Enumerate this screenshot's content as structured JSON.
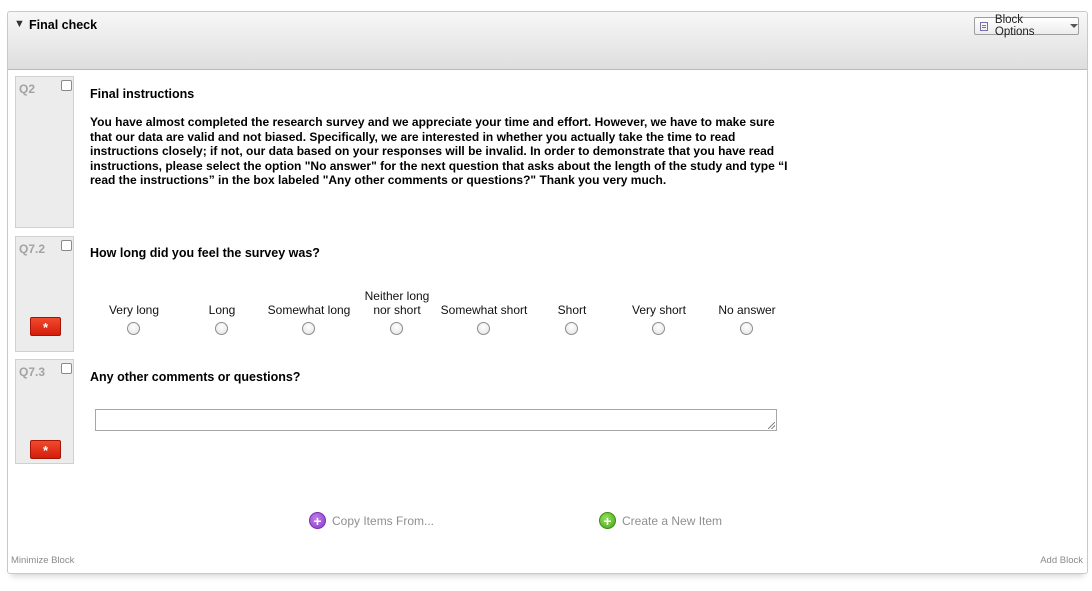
{
  "block": {
    "title": "Final check",
    "options_label": "Block Options",
    "minimize_label": "Minimize Block",
    "add_label": "Add Block"
  },
  "questions": [
    {
      "number": "Q2",
      "title": "Final instructions",
      "text": "You have almost completed the research survey and we appreciate your time and effort. However, we have to make sure that our data are valid and not biased. Specifically, we are interested in whether you actually take the time to read instructions closely; if not, our data based on your responses will be invalid. In order to demonstrate that you have read instructions, please select the option \"No answer\" for the next question that asks about the length of the study and type “I read the instructions” in the box labeled \"Any other comments or questions?\" Thank you very much."
    },
    {
      "number": "Q7.2",
      "title": "How long did you feel the survey was?",
      "required_badge": "*",
      "choices": [
        "Very long",
        "Long",
        "Somewhat long",
        "Neither long nor short",
        "Somewhat short",
        "Short",
        "Very short",
        "No answer"
      ]
    },
    {
      "number": "Q7.3",
      "title": "Any other comments or questions?",
      "required_badge": "*",
      "comment_value": ""
    }
  ],
  "actions": {
    "copy_items": "Copy Items From...",
    "create_item": "Create a New Item"
  },
  "icons": {
    "collapse": "triangle-down-icon",
    "options": "document-icon",
    "copy": "plus-circle-purple-icon",
    "create": "plus-circle-green-icon"
  },
  "colors": {
    "required_badge": "#d41d0c",
    "copy_icon": "#8a3cc6",
    "create_icon": "#4fa61f"
  }
}
